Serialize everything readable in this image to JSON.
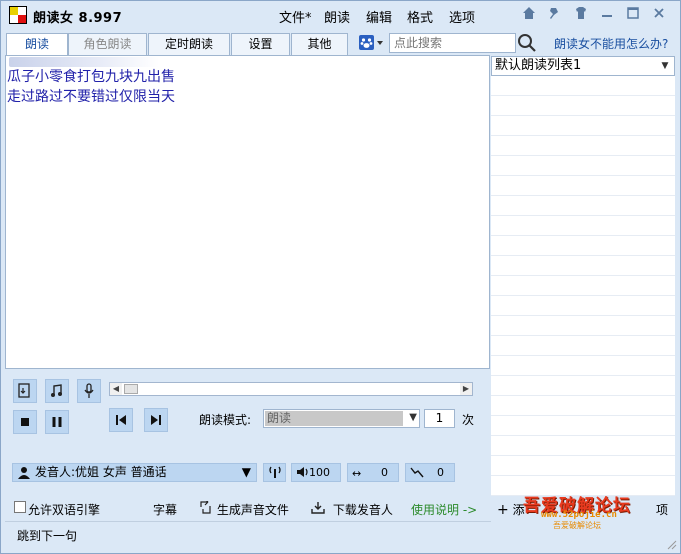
{
  "app": {
    "title": "朗读女 8.997"
  },
  "menu": [
    "文件*",
    "朗读",
    "编辑",
    "格式",
    "选项"
  ],
  "tabs": [
    "朗读",
    "角色朗读",
    "定时朗读",
    "设置",
    "其他"
  ],
  "search": {
    "placeholder": "点此搜索"
  },
  "help_link": "朗读女不能用怎么办?",
  "editor": {
    "lines": [
      "瓜子小零食打包九块九出售",
      "走过路过不要错过仅限当天"
    ]
  },
  "playlist": {
    "selected": "默认朗读列表1"
  },
  "playback": {
    "mode_label": "朗读模式:",
    "mode_value": "朗读",
    "count": "1",
    "count_unit": "次"
  },
  "speaker": {
    "label": "发音人:优姐 女声 普通话"
  },
  "volume": "100",
  "speed": "0",
  "pitch": "0",
  "bottom": {
    "bilingual": "允许双语引擎",
    "subtitles": "字幕",
    "generate": "生成声音文件",
    "download": "下载发音人",
    "usage": "使用说明 ->",
    "add": "添",
    "item": "项"
  },
  "status": "跳到下一句",
  "watermark": {
    "title": "吾爱破解论坛",
    "url1": "www.52pojie.cn",
    "url2": "吾爱破解论坛"
  },
  "colors": {
    "accent": "#1a4fa0",
    "text_blue": "#2222aa",
    "button_bg": "#bcd6f1"
  }
}
